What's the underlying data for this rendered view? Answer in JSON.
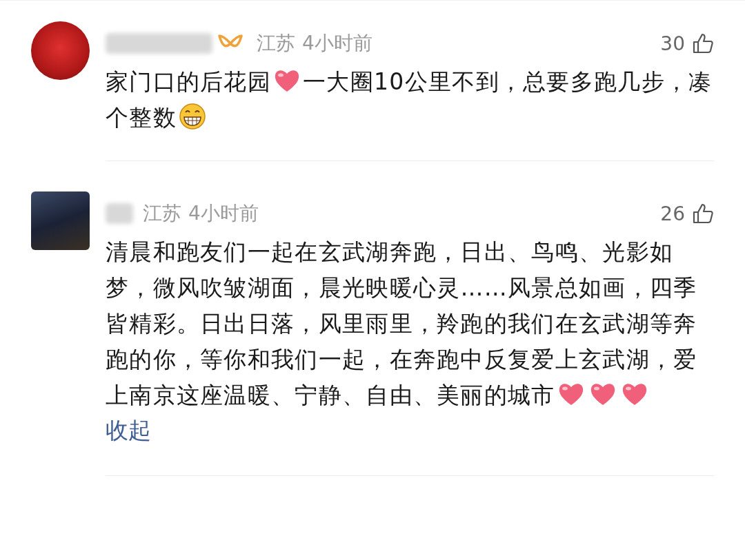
{
  "comments": [
    {
      "kind": "round",
      "badge": true,
      "location": "江苏",
      "time": "4小时前",
      "likes": "30",
      "parts": [
        {
          "kind": "text",
          "text": "家门口的后花园"
        },
        {
          "kind": "heart"
        },
        {
          "kind": "text",
          "text": "一大圈10公里不到，总要多跑几步，凑个整数"
        },
        {
          "kind": "grin"
        }
      ]
    },
    {
      "kind": "square",
      "badge": false,
      "location": "江苏",
      "time": "4小时前",
      "likes": "26",
      "parts": [
        {
          "kind": "text",
          "text": "清晨和跑友们一起在玄武湖奔跑，日出、鸟鸣、光影如梦，微风吹皱湖面，晨光映暖心灵……风景总如画，四季皆精彩。日出日落，风里雨里，羚跑的我们在玄武湖等奔跑的你，等你和我们一起，在奔跑中反复爱上玄武湖，爱上南京这座温暖、宁静、自由、美丽的城市"
        },
        {
          "kind": "heart"
        },
        {
          "kind": "heart"
        },
        {
          "kind": "heart"
        }
      ],
      "collapse": "收起"
    }
  ]
}
